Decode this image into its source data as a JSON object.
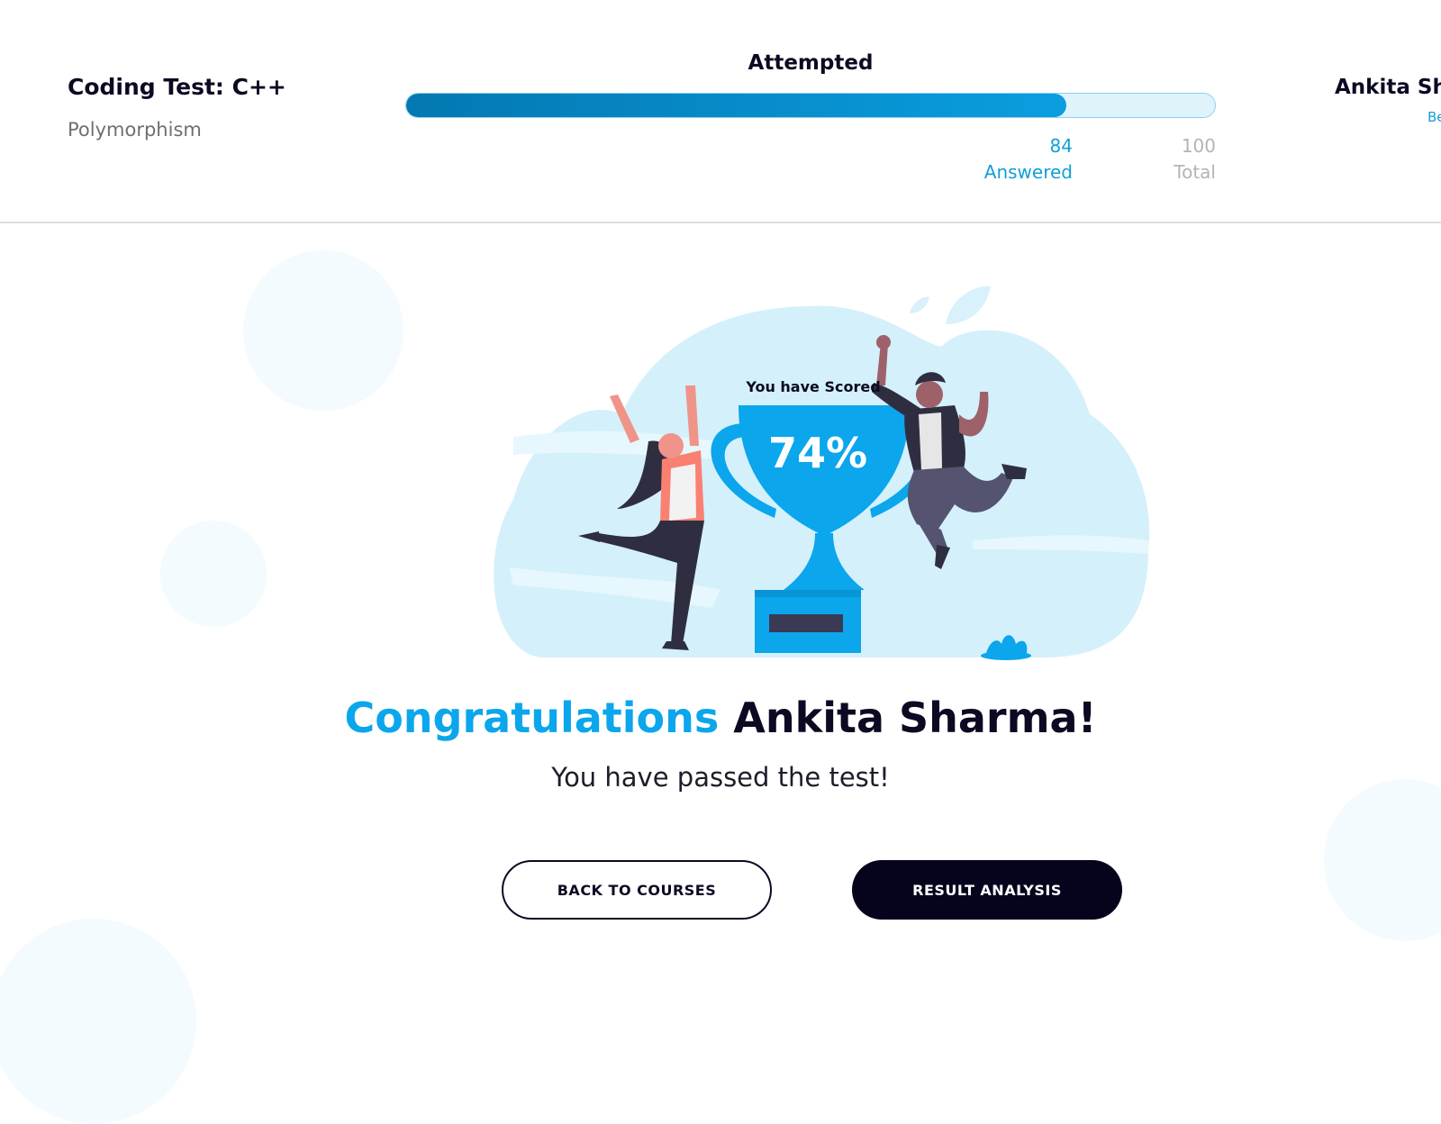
{
  "header": {
    "test_title": "Coding Test: C++",
    "test_topic": "Polymorphism",
    "progress": {
      "label": "Attempted",
      "answered_value": "84",
      "answered_label": "Answered",
      "total_value": "100",
      "total_label": "Total",
      "fraction": 0.816
    },
    "user": {
      "name": "Ankita Sha",
      "subtitle": "Be"
    }
  },
  "result": {
    "scored_label": "You have Scored",
    "score": "74%",
    "congrats_word": "Congratulations",
    "congrats_name": "Ankita Sharma!",
    "message": "You have passed the test!"
  },
  "actions": {
    "back_label": "BACK TO COURSES",
    "analysis_label": "RESULT ANALYSIS"
  },
  "colors": {
    "accent": "#0ba6ec",
    "dark": "#0b0a22",
    "cloud": "#d4f0fb",
    "trophy": "#0ba6ec"
  }
}
